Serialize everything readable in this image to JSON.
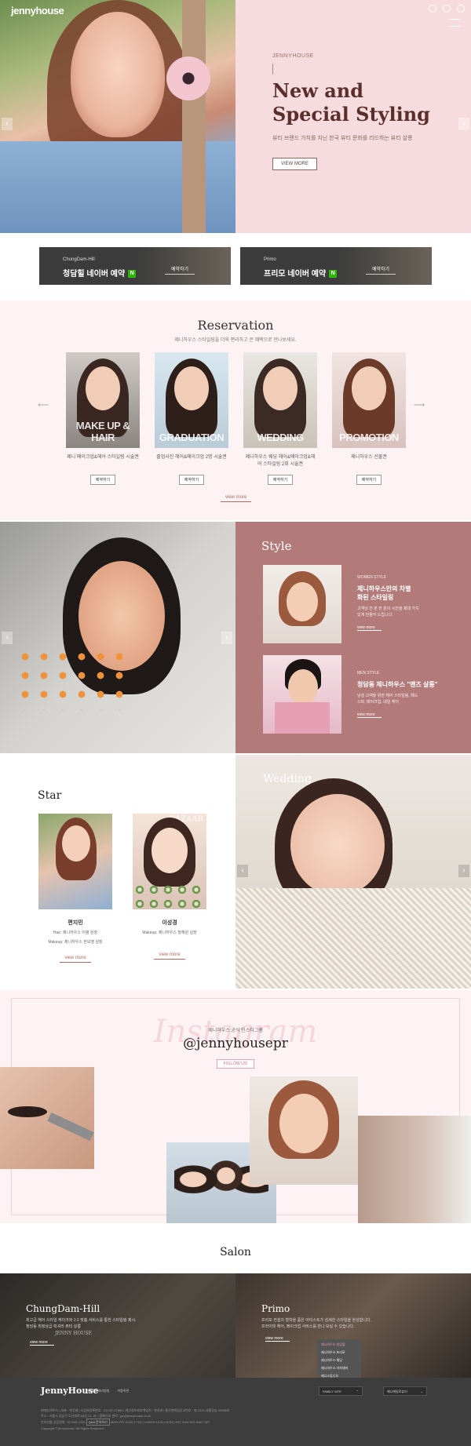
{
  "header": {
    "logo": "jennyhouse",
    "icons": [
      "instagram-icon",
      "youtube-icon",
      "kakao-icon"
    ]
  },
  "hero": {
    "brand": "JENNYHOUSE",
    "title_line1": "New and",
    "title_line2": "Special Styling",
    "desc": "뷰티 브랜드 가치를 지닌 한국 뷰티 문화를 리드하는 뷰티 살롱",
    "button": "VIEW MORE",
    "prev": "‹",
    "next": "›"
  },
  "booking": [
    {
      "branch": "ChungDam-Hill",
      "label": "청담힐 네이버 예약",
      "naver": "N",
      "go": "예약하기"
    },
    {
      "branch": "Primo",
      "label": "프리모 네이버 예약",
      "naver": "N",
      "go": "예약하기"
    }
  ],
  "reservation": {
    "title": "Reservation",
    "sub": "제니하우스 스타일링을 더욱 편리하고 큰 혜택으로 만나보세요.",
    "cards": [
      {
        "caption": "MAKE UP & HAIR",
        "desc": "제니 메이크업&헤어 스타일링 시술권",
        "btn": "예약하기"
      },
      {
        "caption": "GRADUATION",
        "desc": "졸업사진 헤어&메이크업 2명 시술권",
        "btn": "예약하기"
      },
      {
        "caption": "WEDDING",
        "desc": "제니하우스 웨딩 헤어&메이크업&헤어 스타일링 2회 시술권",
        "btn": "예약하기"
      },
      {
        "caption": "PROMOTION",
        "desc": "제니하우스 선불권",
        "btn": "예약하기"
      }
    ],
    "view_more": "view more"
  },
  "style": {
    "title": "Style",
    "items": [
      {
        "tag": "WOMEN STYLE",
        "title": "제니하우스만의 차별화된 스타일링",
        "desc": "고객님 한 분 한 분의 시간을 제대 가치있게 만들어 드립니다.",
        "more": "view more"
      },
      {
        "tag": "MEN STYLE",
        "title": "청담동 제니하우스 \"맨즈 살롱\"",
        "desc": "남성 고객을 위한 헤어 스타일링, 헤드 스파, 메이크업, 네일 케어",
        "more": "view more"
      }
    ]
  },
  "star": {
    "title": "Star",
    "items": [
      {
        "name": "편지민",
        "desc1": "Hair: 제니하우스 이병 원장",
        "desc2": "Makeup: 제니하우스 한보영 원장",
        "more": "view more"
      },
      {
        "name": "이성경",
        "desc1": "Makeup: 제니하우스 정혜원 실장",
        "desc2": "",
        "more": "view more",
        "badge": "BAZAAR"
      }
    ]
  },
  "wedding": {
    "title": "Wedding"
  },
  "instagram": {
    "bg_text": "Instagram",
    "sub": "제니하우스 공식 인스타그램",
    "handle": "@jennyhousepr",
    "follow": "FOLLOW US!"
  },
  "salon": {
    "title": "Salon",
    "items": [
      {
        "name": "ChungDam-Hill",
        "desc1": "최고급 헤어 스타일 케이크와 1:1 맞춤 서비스를 통한 스타일링 제시.",
        "desc2": "청담동 최정상급 럭셔리 뷰티 살롱",
        "sign": "JENNY HOUSE",
        "more": "view more"
      },
      {
        "name": "Primo",
        "desc1": "프리모 컨셉의 철학을 품은 아티스트가 섬세한 스타일을 완성합니다.",
        "desc2": "프라이빗 헤어, 메이크업 서비스를 만나 보실 수 있습니다.",
        "more": "view more"
      }
    ],
    "dropdown": [
      "제니하우스 청담힐",
      "제니하우스 프리모",
      "제니하우스 웨딩",
      "제니하우스 아카데미",
      "제니스튜디오"
    ]
  },
  "footer": {
    "logo": "JennyHouse",
    "links": [
      "개인정보처리방침",
      "이용약관"
    ],
    "family_site": "FAMILY SITE",
    "select2": "제니헤일로뷰티",
    "info1": "㈜제니하우스 | 대표 : 현성혜 | 사업자등록번호 : 211-87-97894 | 개인정보보호책임자 : 현성혜 | 통신판매업신고번호 : 제 2013-서울강남-00005호",
    "info2": "주소 : 서울시 강남구 도산대로 68길 21, 6F | 홈페이지 관리 : jpr@jennyhouse.co.kr",
    "info3": "온라인몰 상담전화 : 02-545-7205",
    "chip": "Q&A 문의하기",
    "info4": "MON-FRI 10:00-17:00 | LUNCH 12:00-13:00 | SAT-SUN HOLIDAY OFF",
    "copyright": "Copyright © jennyhouse. All Rights Reserved."
  },
  "colors": {
    "hero_bg": "#f6dcdf",
    "style_bg": "#b27b7a",
    "accent": "#b06a5f",
    "footer_bg": "#3d3d3d"
  }
}
